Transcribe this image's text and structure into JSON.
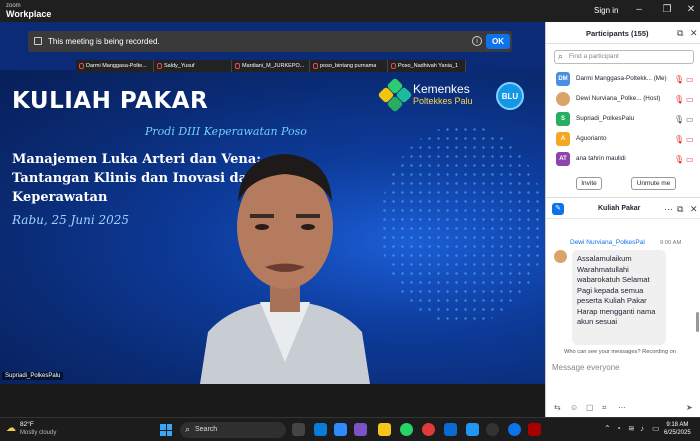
{
  "titlebar": {
    "logo_line1": "zoom",
    "logo_line2": "Workplace",
    "signin": "Sign in"
  },
  "banner": {
    "text": "This meeting is being recorded.",
    "ok": "OK"
  },
  "thumbnails": [
    "Darmi Manggasa-Polte...",
    "Saldy_Yusuf",
    "Mardiani_M_JURKEPO...",
    "poso_bintang purnama",
    "Poso_Nadhivah Yania_1"
  ],
  "slide": {
    "heading": "KULIAH PAKAR",
    "subtitle": "Prodi DIII Keperawatan Poso",
    "title_line1": "Manajemen Luka Arteri dan Vena:",
    "title_line2": "Tantangan Klinis dan Inovasi dalam",
    "title_line3": "Keperawatan",
    "date": "Rabu, 25 Juni 2025",
    "brand_name": "Kemenkes",
    "brand_sub": "Poltekkes Palu",
    "blu": "BLU"
  },
  "video_name_tag": "Supriadi_PolkesPalu",
  "participants": {
    "title": "Participants (155)",
    "search_placeholder": "Find a participant",
    "list": [
      {
        "initials": "DM",
        "name": "Darmi Manggasa-Poltekk... (Me)",
        "color": "#4a90e2",
        "mic_on": false
      },
      {
        "initials": "",
        "name": "Dewi Nurviana_Polke... (Host)",
        "color": "#d9a36a",
        "mic_on": false
      },
      {
        "initials": "S",
        "name": "Supriadi_PolkesPalu",
        "color": "#27ae60",
        "mic_on": true
      },
      {
        "initials": "A",
        "name": "Aguorianto",
        "color": "#f5a623",
        "mic_on": false
      },
      {
        "initials": "AT",
        "name": "ana tahrin maulidi",
        "color": "#8e44ad",
        "mic_on": false
      }
    ],
    "invite": "Invite",
    "unmute_me": "Unmute me"
  },
  "chat": {
    "title": "Kuliah Pakar",
    "sender": "Dewi Nurviana_PolkesPal",
    "time": "9:00 AM",
    "message": "Assalamulaikum Warahmatullahi wabarokatuh Selamat Pagi kepada semua peserta Kuliah Pakar Harap mengganti nama akun sesuai",
    "who_can_see": "Who can see your messages? Recording on",
    "input_placeholder": "Message everyone"
  },
  "taskbar": {
    "temp": "82°F",
    "weather": "Mostly cloudy",
    "search": "Search",
    "time": "9:18 AM",
    "date": "6/25/2025"
  }
}
